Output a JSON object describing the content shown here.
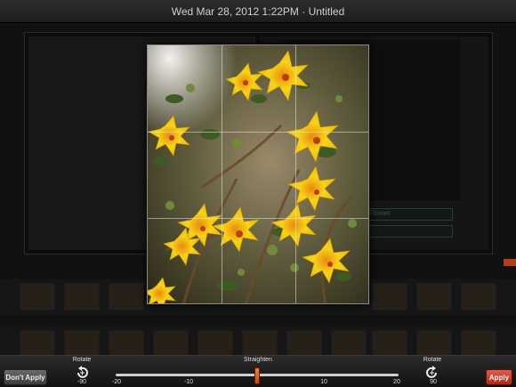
{
  "header": {
    "title": "Wed Mar 28, 2012 1:22PM · Untitled"
  },
  "book": {
    "captions": [
      "Flower",
      ""
    ]
  },
  "toolbar": {
    "dont_apply_label": "Don't Apply",
    "apply_label": "Apply",
    "rotate_left": {
      "label": "Rotate",
      "value": "-90",
      "icon": "rotate-ccw-icon"
    },
    "rotate_right": {
      "label": "Rotate",
      "value": "90",
      "icon": "rotate-cw-icon"
    },
    "straighten": {
      "label": "Straighten",
      "ticks": [
        "-20",
        "-10",
        "10",
        "20"
      ],
      "value": 0,
      "min": -20,
      "max": 20
    }
  },
  "colors": {
    "accent": "#e23b2a",
    "slider_thumb": "#f26522",
    "background": "#111111"
  }
}
